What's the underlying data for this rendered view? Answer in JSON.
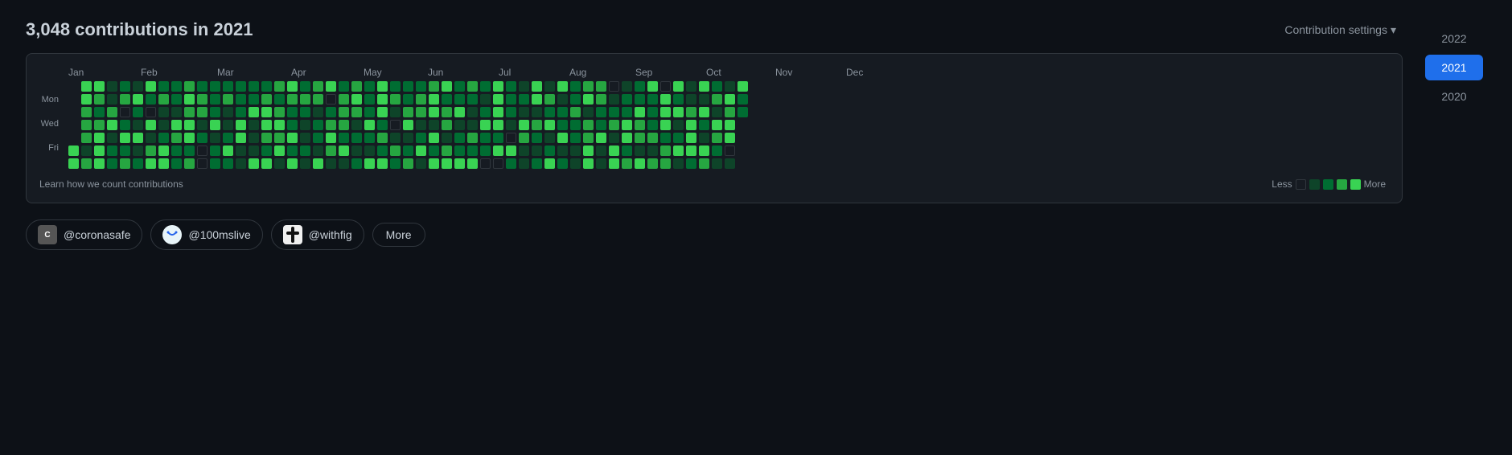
{
  "header": {
    "title": "3,048 contributions in 2021",
    "settings_label": "Contribution settings",
    "settings_chevron": "▾"
  },
  "months": [
    "Jan",
    "Feb",
    "Mar",
    "Apr",
    "May",
    "Jun",
    "Jul",
    "Aug",
    "Sep",
    "Oct",
    "Nov",
    "Dec"
  ],
  "day_labels": [
    {
      "label": "",
      "row": 0
    },
    {
      "label": "Mon",
      "row": 1
    },
    {
      "label": "",
      "row": 2
    },
    {
      "label": "Wed",
      "row": 3
    },
    {
      "label": "",
      "row": 4
    },
    {
      "label": "Fri",
      "row": 5
    },
    {
      "label": "",
      "row": 6
    }
  ],
  "legend": {
    "less_label": "Less",
    "more_label": "More",
    "levels": [
      "level-0",
      "level-1",
      "level-2",
      "level-3",
      "level-4"
    ]
  },
  "footer": {
    "learn_link": "Learn how we count contributions"
  },
  "orgs": [
    {
      "name": "@coronasafe",
      "icon_type": "cs"
    },
    {
      "name": "@100mslive",
      "icon_type": "hms"
    },
    {
      "name": "@withfig",
      "icon_type": "fig"
    },
    {
      "name": "More",
      "icon_type": "none"
    }
  ],
  "sidebar": {
    "years": [
      {
        "label": "2022",
        "active": false
      },
      {
        "label": "2021",
        "active": true
      },
      {
        "label": "2020",
        "active": false
      }
    ]
  }
}
